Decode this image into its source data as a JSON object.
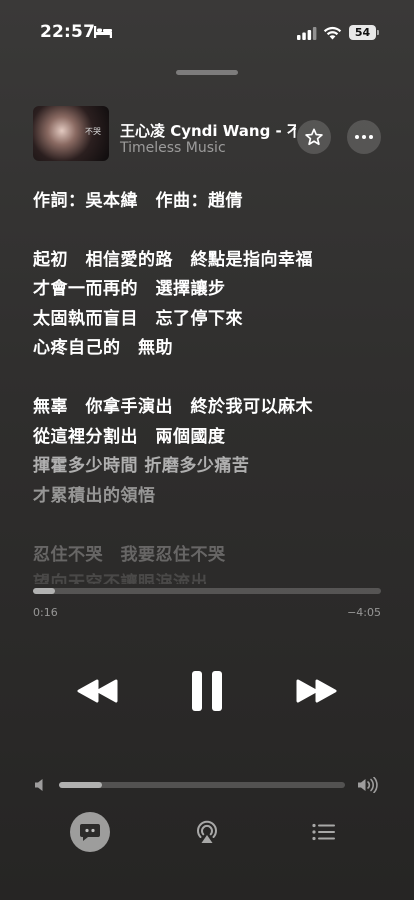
{
  "status_bar": {
    "time": "22:57",
    "battery": "54"
  },
  "now_playing": {
    "title": "王心凌 Cyndi Wang - 不是我不哭",
    "album": "Timeless Music",
    "artwork_text": "不哭"
  },
  "lyrics": [
    {
      "text": "作詞：吳本緯　作曲：趙倩",
      "opacity": 1.0
    },
    {
      "text": "起初　相信愛的路　終點是指向幸福",
      "opacity": 1.0
    },
    {
      "text": "才會一而再的　選擇讓步",
      "opacity": 1.0
    },
    {
      "text": "太固執而盲目　忘了停下來",
      "opacity": 1.0
    },
    {
      "text": "心疼自己的　無助",
      "opacity": 1.0
    },
    {
      "text": "無辜　你拿手演出　終於我可以麻木",
      "opacity": 1.0
    },
    {
      "text": "從這裡分割出　兩個國度",
      "opacity": 1.0
    },
    {
      "text": "揮霍多少時間 折磨多少痛苦",
      "opacity": 0.62
    },
    {
      "text": "才累積出的領悟",
      "opacity": 0.5
    },
    {
      "text": "忍住不哭　我要忍住不哭",
      "opacity": 0.28
    },
    {
      "text": "望向天空不讓眼淚流出",
      "opacity": 0.14
    }
  ],
  "playback": {
    "elapsed": "0:16",
    "remaining": "−4:05",
    "progress_fraction": 0.062
  },
  "volume": {
    "level_fraction": 0.15
  },
  "icons": {
    "bed": "bed-icon",
    "signal": "signal-icon",
    "wifi": "wifi-icon",
    "star": "star-icon",
    "more": "more-icon",
    "rewind": "rewind-icon",
    "pause": "pause-icon",
    "forward": "forward-icon",
    "volume_low": "volume-low-icon",
    "volume_high": "volume-high-icon",
    "lyrics": "lyrics-icon",
    "airplay": "airplay-icon",
    "queue": "queue-icon"
  },
  "colors": {
    "background": "#302f2e",
    "text": "#ffffff"
  }
}
